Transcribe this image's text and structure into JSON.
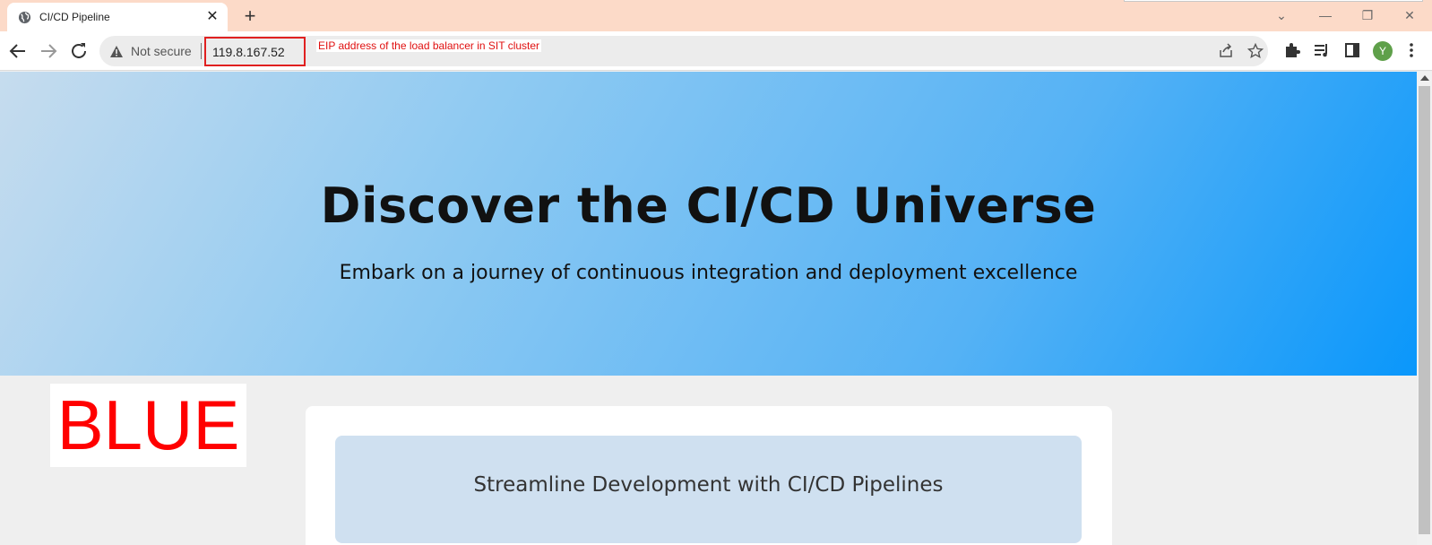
{
  "browser": {
    "tab": {
      "title": "CI/CD Pipeline",
      "favicon": "globe-icon",
      "close_glyph": "✕"
    },
    "new_tab_glyph": "+",
    "window_controls": {
      "dropdown": "⌄",
      "minimize": "—",
      "restore": "❐",
      "close": "✕"
    },
    "toolbar": {
      "security_text": "Not secure",
      "url": "119.8.167.52",
      "url_annotation": "EIP address of the load balancer in SIT cluster",
      "profile_initial": "Y"
    },
    "colors": {
      "tab_strip": "#fcdac8",
      "annotation_red": "#e02020"
    }
  },
  "page": {
    "hero": {
      "title": "Discover the CI/CD Universe",
      "subtitle": "Embark on a journey of continuous integration and deployment excellence"
    },
    "version_label": "BLUE",
    "card": {
      "title": "Streamline Development with CI/CD Pipelines"
    }
  }
}
